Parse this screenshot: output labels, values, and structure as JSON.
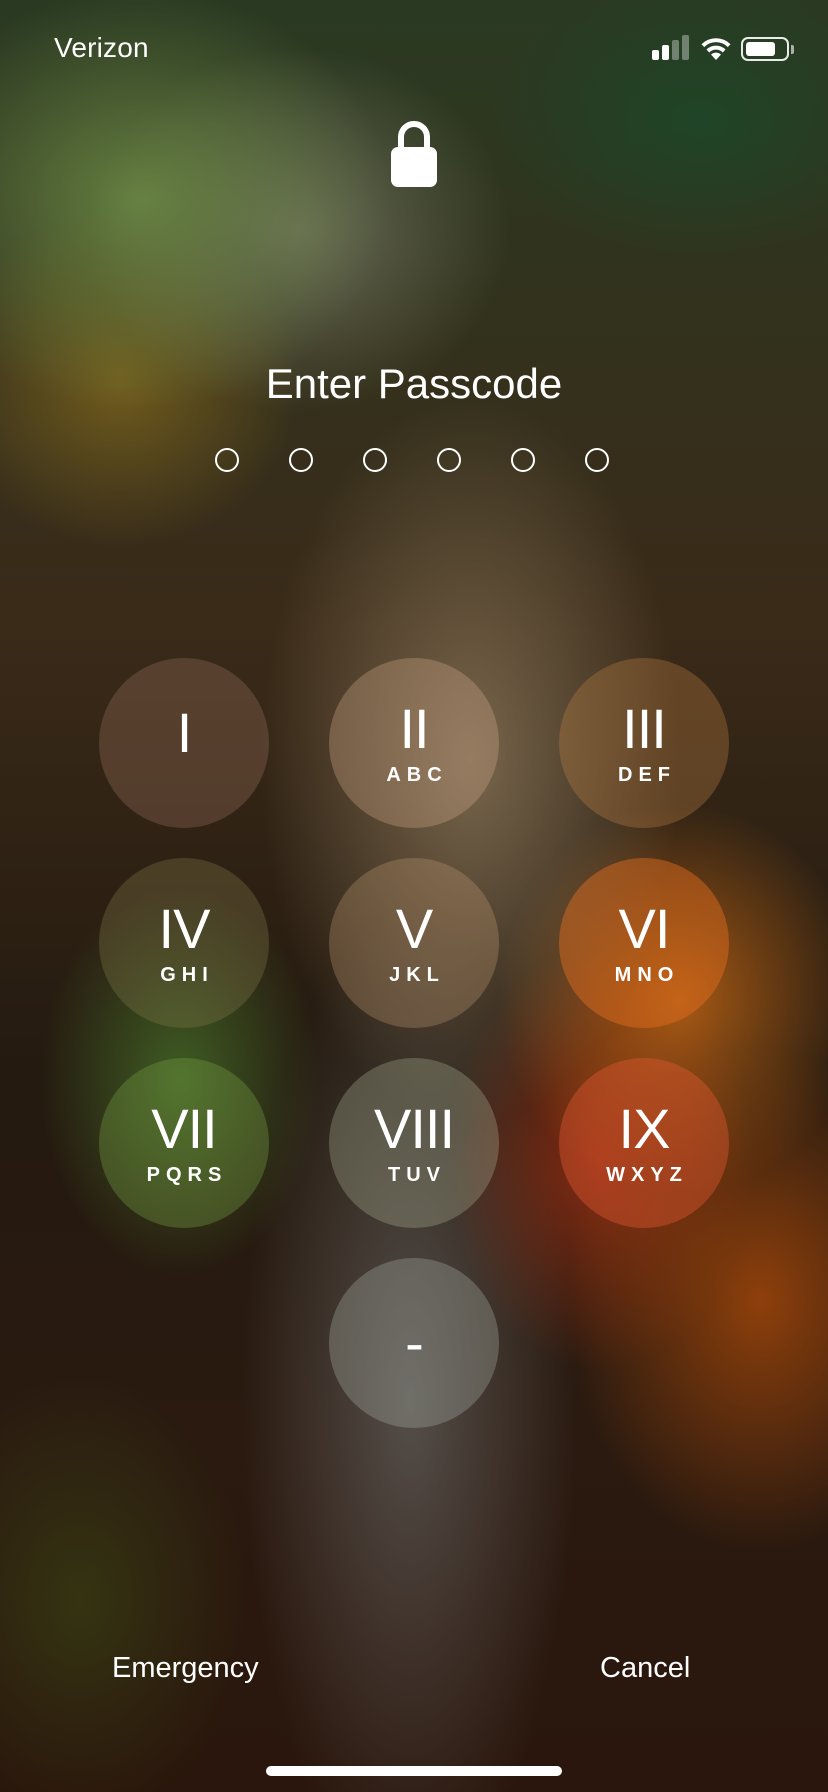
{
  "status_bar": {
    "carrier": "Verizon",
    "signal_icon": "signal-bars-icon",
    "wifi_icon": "wifi-icon",
    "battery_icon": "battery-icon",
    "battery_level": 0.75,
    "signal_bars_active": 2
  },
  "lock_icon": "lock-icon",
  "title": "Enter Passcode",
  "passcode": {
    "length": 6,
    "entered": 0
  },
  "keypad": [
    {
      "digit": "I",
      "letters": ""
    },
    {
      "digit": "II",
      "letters": "ABC"
    },
    {
      "digit": "III",
      "letters": "DEF"
    },
    {
      "digit": "IV",
      "letters": "GHI"
    },
    {
      "digit": "V",
      "letters": "JKL"
    },
    {
      "digit": "VI",
      "letters": "MNO"
    },
    {
      "digit": "VII",
      "letters": "PQRS"
    },
    {
      "digit": "VIII",
      "letters": "TUV"
    },
    {
      "digit": "IX",
      "letters": "WXYZ"
    },
    {
      "digit": "-",
      "letters": ""
    }
  ],
  "footer": {
    "emergency_label": "Emergency",
    "cancel_label": "Cancel"
  },
  "colors": {
    "text": "#ffffff",
    "key_fill": "rgba(255,255,255,0.16)"
  }
}
